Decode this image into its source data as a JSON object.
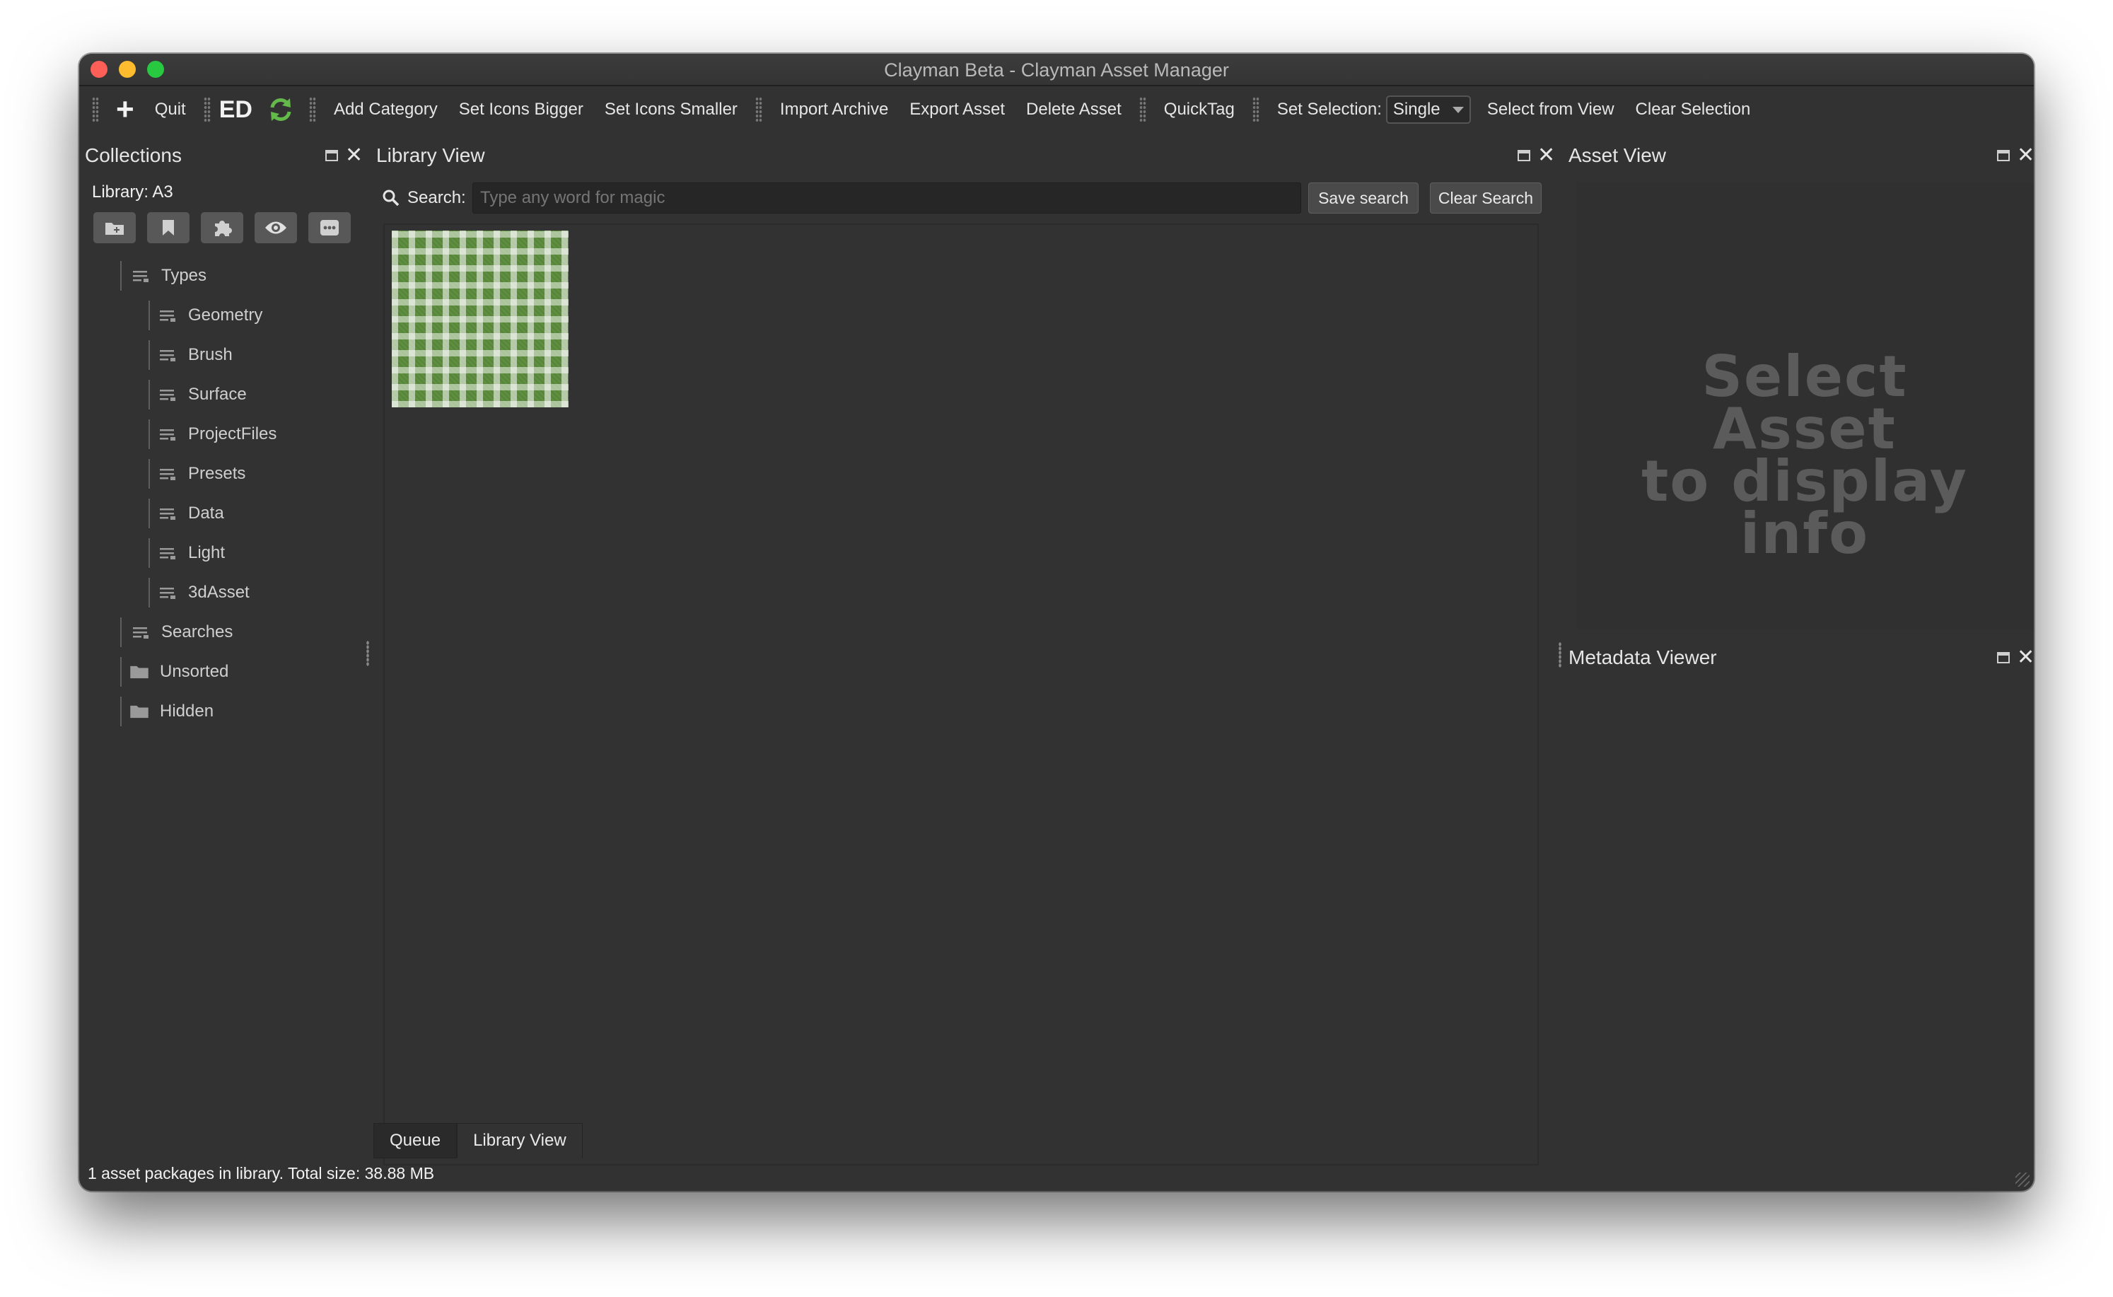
{
  "window": {
    "title": "Clayman Beta - Clayman Asset Manager"
  },
  "toolbar": {
    "add_label": "+",
    "quit": "Quit",
    "ed": "ED",
    "add_category": "Add Category",
    "set_icons_bigger": "Set Icons Bigger",
    "set_icons_smaller": "Set Icons Smaller",
    "import_archive": "Import Archive",
    "export_asset": "Export Asset",
    "delete_asset": "Delete Asset",
    "quicktag": "QuickTag",
    "set_selection_label": "Set Selection:",
    "selection_value": "Single",
    "select_from_view": "Select from View",
    "clear_selection": "Clear Selection"
  },
  "collections": {
    "title": "Collections",
    "library_label": "Library: A3",
    "tree": {
      "types": "Types",
      "children": [
        "Geometry",
        "Brush",
        "Surface",
        "ProjectFiles",
        "Presets",
        "Data",
        "Light",
        "3dAsset"
      ],
      "searches": "Searches",
      "unsorted": "Unsorted",
      "hidden": "Hidden"
    }
  },
  "library_view": {
    "title": "Library View",
    "search_label": "Search:",
    "search_placeholder": "Type any word for magic",
    "save_search": "Save search",
    "clear_search": "Clear Search"
  },
  "asset_view": {
    "title": "Asset View",
    "placeholder_line1": "Select Asset",
    "placeholder_line2": "to display info"
  },
  "metadata_viewer": {
    "title": "Metadata Viewer"
  },
  "tabs": [
    "Queue",
    "Library View"
  ],
  "status": "1 asset packages in library. Total size: 38.88 MB",
  "colors": {
    "window_bg": "#323232",
    "accent_green": "#63b94a",
    "close_red": "#fe5f57",
    "minimize_yellow": "#febc2e",
    "zoom_green": "#28c840"
  }
}
